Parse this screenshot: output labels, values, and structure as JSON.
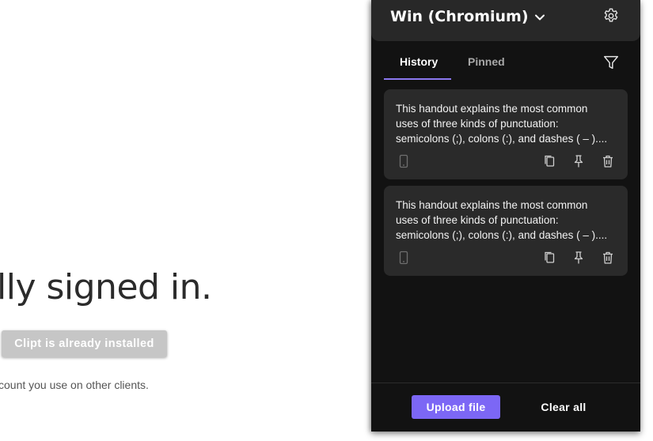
{
  "background_page": {
    "heading": "lly signed in.",
    "install_button": "Clipt is already installed",
    "note": "count you use on other clients."
  },
  "popup": {
    "device_name": "Win (Chromium)",
    "icons": {
      "device_menu": "chevron-down-icon",
      "settings": "gear-icon",
      "filter": "filter-icon",
      "device": "phone-icon",
      "copy": "copy-icon",
      "pin": "pin-icon",
      "delete": "trash-icon"
    },
    "tabs": [
      {
        "label": "History",
        "active": true
      },
      {
        "label": "Pinned",
        "active": false
      }
    ],
    "clips": [
      {
        "text": "This handout explains the most common\nuses of three kinds of punctuation:\nsemicolons (;), colons (:), and dashes ( – )...."
      },
      {
        "text": "This handout explains the most common\nuses of three kinds of punctuation:\nsemicolons (;), colons (:), and dashes ( – )...."
      }
    ],
    "footer": {
      "upload_label": "Upload file",
      "clear_label": "Clear all"
    },
    "colors": {
      "accent": "#7c67f5",
      "background": "#121212",
      "card": "#2a2a2a",
      "header": "#282828"
    }
  }
}
